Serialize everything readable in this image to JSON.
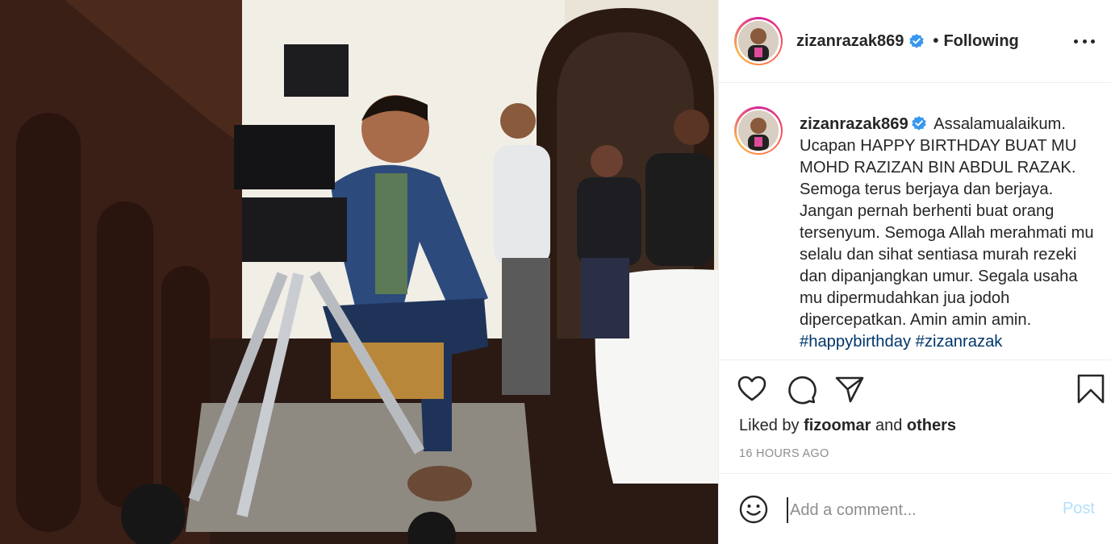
{
  "post": {
    "photo_alt": "",
    "colors": {
      "link": "#00376b",
      "muted": "#8e8e8e",
      "verified": "#3897f0",
      "post_disabled": "#b2dffc"
    }
  },
  "header": {
    "username": "zizanrazak869",
    "separator": "•",
    "follow_state": "Following",
    "more_icon": "more-horizontal-icon"
  },
  "caption": {
    "username": "zizanrazak869",
    "text": "Assalamualaikum. Ucapan HAPPY BIRTHDAY BUAT MU MOHD RAZIZAN BIN ABDUL RAZAK. Semoga terus berjaya dan berjaya. Jangan pernah berhenti buat orang tersenyum. Semoga Allah merahmati mu selalu dan sihat sentiasa murah rezeki dan dipanjangkan umur. Segala usaha mu dipermudahkan jua jodoh dipercepatkan. Amin amin amin.",
    "hashtag1": "#happybirthday",
    "hashtag2": "#zizanrazak"
  },
  "actions": {
    "icons": [
      "heart-icon",
      "comment-icon",
      "share-icon",
      "bookmark-icon"
    ],
    "liked_prefix": "Liked by",
    "liked_user": "fizoomar",
    "liked_and": "and",
    "liked_others": "others",
    "timestamp": "16 HOURS AGO"
  },
  "comment": {
    "placeholder": "Add a comment...",
    "post_label": "Post",
    "emoji_icon": "smiley-icon"
  }
}
